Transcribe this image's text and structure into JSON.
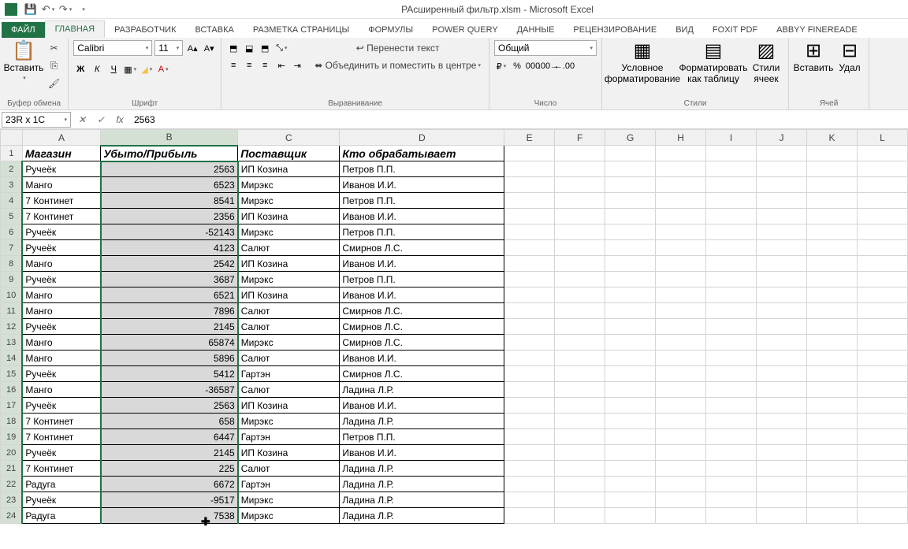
{
  "title": "РАсширенный фильтр.xlsm - Microsoft Excel",
  "tabs": {
    "file": "ФАЙЛ",
    "home": "ГЛАВНАЯ",
    "dev": "РАЗРАБОТЧИК",
    "insert": "ВСТАВКА",
    "layout": "РАЗМЕТКА СТРАНИЦЫ",
    "formulas": "ФОРМУЛЫ",
    "pq": "POWER QUERY",
    "data": "ДАННЫЕ",
    "review": "РЕЦЕНЗИРОВАНИЕ",
    "view": "ВИД",
    "foxit": "FOXIT PDF",
    "abbyy": "ABBYY FineReade"
  },
  "ribbon": {
    "clipboard": {
      "paste": "Вставить",
      "label": "Буфер обмена"
    },
    "font": {
      "name": "Calibri",
      "size": "11",
      "label": "Шрифт",
      "bold": "Ж",
      "italic": "К",
      "underline": "Ч"
    },
    "align": {
      "wrap": "Перенести текст",
      "merge": "Объединить и поместить в центре",
      "label": "Выравнивание"
    },
    "number": {
      "format": "Общий",
      "label": "Число"
    },
    "styles": {
      "cond": "Условное форматирование",
      "table": "Форматировать как таблицу",
      "cell": "Стили ячеек",
      "label": "Стили"
    },
    "cells": {
      "insert": "Вставить",
      "delete": "Удал",
      "label": "Ячей"
    }
  },
  "namebox": "23R x 1C",
  "formula": "2563",
  "cols": [
    "A",
    "B",
    "C",
    "D",
    "E",
    "F",
    "G",
    "H",
    "I",
    "J",
    "K",
    "L"
  ],
  "headers": {
    "a": "Магазин",
    "b": "Убыто/Прибыль",
    "c": "Поставщик",
    "d": "Кто обрабатывает"
  },
  "rows": [
    {
      "n": 2,
      "a": "Ручеёк",
      "b": "2563",
      "c": "ИП Козина",
      "d": "Петров П.П."
    },
    {
      "n": 3,
      "a": "Манго",
      "b": "6523",
      "c": "Мирэкс",
      "d": "Иванов И.И."
    },
    {
      "n": 4,
      "a": "7 Континет",
      "b": "8541",
      "c": "Мирэкс",
      "d": "Петров П.П."
    },
    {
      "n": 5,
      "a": "7 Континет",
      "b": "2356",
      "c": "ИП Козина",
      "d": "Иванов И.И."
    },
    {
      "n": 6,
      "a": "Ручеёк",
      "b": "-52143",
      "c": "Мирэкс",
      "d": "Петров П.П."
    },
    {
      "n": 7,
      "a": "Ручеёк",
      "b": "4123",
      "c": "Салют",
      "d": "Смирнов Л.С."
    },
    {
      "n": 8,
      "a": "Манго",
      "b": "2542",
      "c": "ИП Козина",
      "d": "Иванов И.И."
    },
    {
      "n": 9,
      "a": "Ручеёк",
      "b": "3687",
      "c": "Мирэкс",
      "d": "Петров П.П."
    },
    {
      "n": 10,
      "a": "Манго",
      "b": "6521",
      "c": "ИП Козина",
      "d": "Иванов И.И."
    },
    {
      "n": 11,
      "a": "Манго",
      "b": "7896",
      "c": "Салют",
      "d": "Смирнов Л.С."
    },
    {
      "n": 12,
      "a": "Ручеёк",
      "b": "2145",
      "c": "Салют",
      "d": "Смирнов Л.С."
    },
    {
      "n": 13,
      "a": "Манго",
      "b": "65874",
      "c": "Мирэкс",
      "d": "Смирнов Л.С."
    },
    {
      "n": 14,
      "a": "Манго",
      "b": "5896",
      "c": "Салют",
      "d": "Иванов И.И."
    },
    {
      "n": 15,
      "a": "Ручеёк",
      "b": "5412",
      "c": "Гартэн",
      "d": "Смирнов Л.С."
    },
    {
      "n": 16,
      "a": "Манго",
      "b": "-36587",
      "c": "Салют",
      "d": "Ладина Л.Р."
    },
    {
      "n": 17,
      "a": "Ручеёк",
      "b": "2563",
      "c": "ИП Козина",
      "d": "Иванов И.И."
    },
    {
      "n": 18,
      "a": "7 Континет",
      "b": "658",
      "c": "Мирэкс",
      "d": "Ладина Л.Р."
    },
    {
      "n": 19,
      "a": "7 Континет",
      "b": "6447",
      "c": "Гартэн",
      "d": "Петров П.П."
    },
    {
      "n": 20,
      "a": "Ручеёк",
      "b": "2145",
      "c": "ИП Козина",
      "d": "Иванов И.И."
    },
    {
      "n": 21,
      "a": "7 Континет",
      "b": "225",
      "c": "Салют",
      "d": "Ладина Л.Р."
    },
    {
      "n": 22,
      "a": "Радуга",
      "b": "6672",
      "c": "Гартэн",
      "d": "Ладина Л.Р."
    },
    {
      "n": 23,
      "a": "Ручеёк",
      "b": "-9517",
      "c": "Мирэкс",
      "d": "Ладина Л.Р."
    },
    {
      "n": 24,
      "a": "Радуга",
      "b": "7538",
      "c": "Мирэкс",
      "d": "Ладина Л.Р."
    }
  ]
}
